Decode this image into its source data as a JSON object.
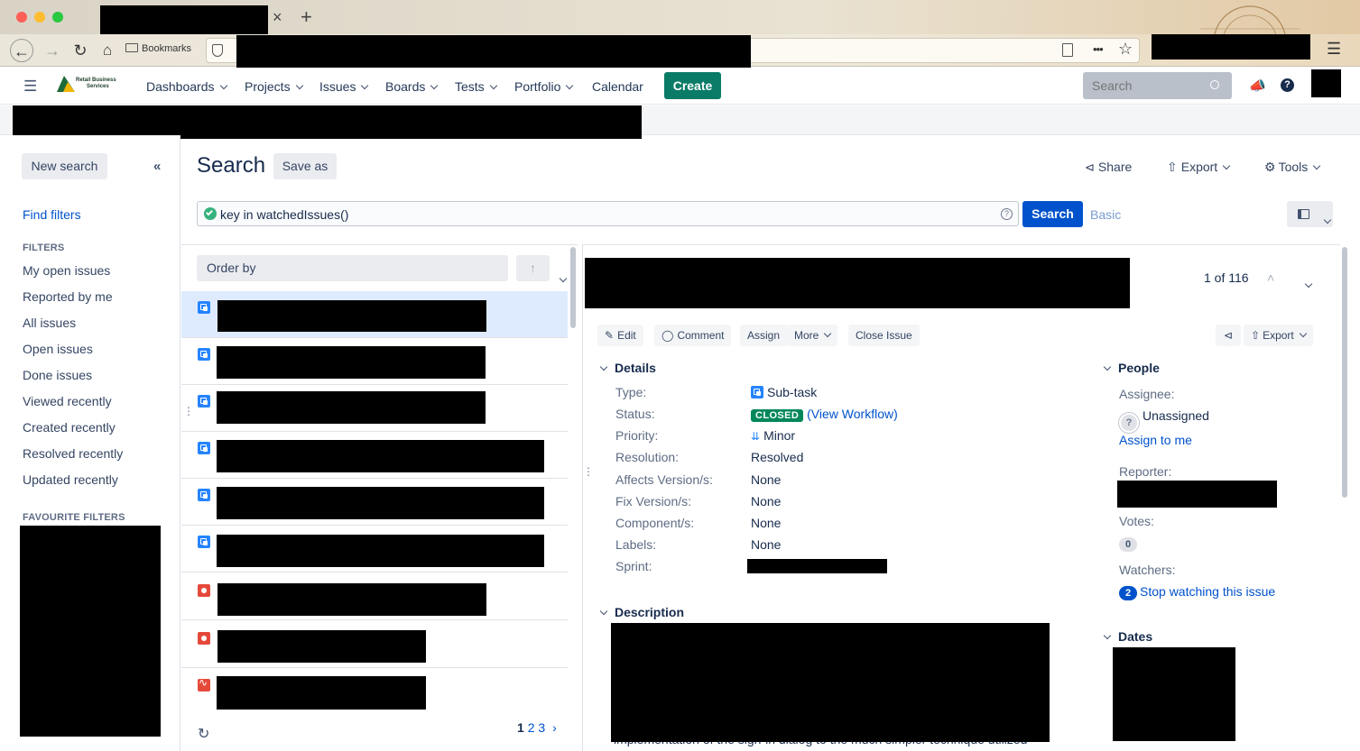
{
  "browser": {
    "new_tab_symbol": "+",
    "close_tab_symbol": "×",
    "bookmarks_label": "Bookmarks",
    "overflow_symbol": "•••"
  },
  "header": {
    "logo_text_line1": "Retail Business",
    "logo_text_line2": "Services",
    "nav": [
      {
        "label": "Dashboards"
      },
      {
        "label": "Projects"
      },
      {
        "label": "Issues"
      },
      {
        "label": "Boards"
      },
      {
        "label": "Tests"
      },
      {
        "label": "Portfolio"
      },
      {
        "label": "Calendar"
      }
    ],
    "create_label": "Create",
    "search_placeholder": "Search"
  },
  "sidebar": {
    "new_search_label": "New search",
    "find_filters_label": "Find filters",
    "filters_heading": "FILTERS",
    "filters": [
      "My open issues",
      "Reported by me",
      "All issues",
      "Open issues",
      "Done issues",
      "Viewed recently",
      "Created recently",
      "Resolved recently",
      "Updated recently"
    ],
    "favourite_heading": "FAVOURITE FILTERS"
  },
  "search": {
    "title": "Search",
    "save_as_label": "Save as",
    "share_label": "Share",
    "export_label": "Export",
    "tools_label": "Tools",
    "jql_query": "key in watchedIssues()",
    "search_button_label": "Search",
    "basic_label": "Basic"
  },
  "list": {
    "order_by_label": "Order by",
    "pages": [
      "1",
      "2",
      "3"
    ],
    "current_page": "1",
    "rows": [
      {
        "type": "subtask",
        "selected": true
      },
      {
        "type": "subtask"
      },
      {
        "type": "subtask"
      },
      {
        "type": "subtask"
      },
      {
        "type": "subtask"
      },
      {
        "type": "subtask"
      },
      {
        "type": "bug"
      },
      {
        "type": "bug"
      },
      {
        "type": "epic"
      }
    ]
  },
  "detail": {
    "position_text": "1 of 116",
    "ops": {
      "edit": "Edit",
      "comment": "Comment",
      "assign": "Assign",
      "more": "More",
      "close_issue": "Close Issue",
      "export": "Export"
    },
    "details_heading": "Details",
    "fields": [
      {
        "label": "Type:",
        "value": "Sub-task"
      },
      {
        "label": "Status:",
        "value": "CLOSED",
        "extra": "(View Workflow)"
      },
      {
        "label": "Priority:",
        "value": "Minor"
      },
      {
        "label": "Resolution:",
        "value": "Resolved"
      },
      {
        "label": "Affects Version/s:",
        "value": "None"
      },
      {
        "label": "Fix Version/s:",
        "value": "None"
      },
      {
        "label": "Component/s:",
        "value": "None"
      },
      {
        "label": "Labels:",
        "value": "None"
      },
      {
        "label": "Sprint:",
        "value": ""
      }
    ],
    "description_heading": "Description",
    "description_visible_text": "implementation of the sign-in dialog to the much simpler technique utilized",
    "people": {
      "heading": "People",
      "assignee_label": "Assignee:",
      "assignee_value": "Unassigned",
      "assign_to_me": "Assign to me",
      "reporter_label": "Reporter:",
      "votes_label": "Votes:",
      "votes_count": "0",
      "watchers_label": "Watchers:",
      "watchers_count": "2",
      "stop_watching": "Stop watching this issue"
    },
    "dates_heading": "Dates"
  },
  "colors": {
    "primary": "#0052cc",
    "create": "#0a7b66",
    "closed_lozenge": "#00875a",
    "selected_row": "#deebff"
  }
}
